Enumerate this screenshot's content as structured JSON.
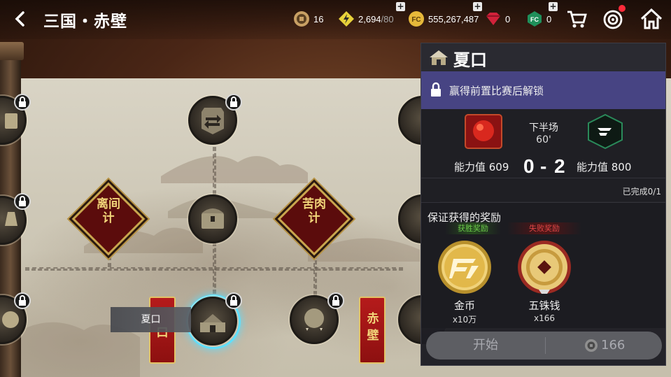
{
  "header": {
    "title": "三国・赤壁"
  },
  "resources": [
    {
      "name": "copper-coin",
      "value": "16",
      "suffix": ""
    },
    {
      "name": "energy",
      "value": "2,694",
      "suffix": "/80"
    },
    {
      "name": "gold-coin",
      "value": "555,267,487",
      "suffix": ""
    },
    {
      "name": "red-gem",
      "value": "0",
      "suffix": ""
    },
    {
      "name": "green-gem",
      "value": "0",
      "suffix": ""
    }
  ],
  "map": {
    "diamond_1": "离间计",
    "diamond_2": "苦肉计",
    "banner_1": "赤壁",
    "banner_partial": "口",
    "tooltip": "夏口"
  },
  "panel": {
    "title": "夏口",
    "unlock_text": "赢得前置比赛后解锁",
    "match": {
      "half": "下半场",
      "minute": "60'",
      "home_power_label": "能力值 609",
      "away_power_label": "能力值 800",
      "home_score": "0",
      "separator": "-",
      "away_score": "2"
    },
    "progress": "已完成0/1",
    "rewards_title": "保证获得的奖励",
    "win_tag": "获胜奖励",
    "lose_tag": "失败奖励",
    "rewards": [
      {
        "name": "金币",
        "qty": "x10万"
      },
      {
        "name": "五铢钱",
        "qty": "x166"
      }
    ],
    "start_label": "开始",
    "cost": "166"
  },
  "colors": {
    "accent_cyan": "#5de0ff",
    "unlock_bar": "#474483",
    "diamond_red": "#5b0c0c",
    "gold": "#c9a64e"
  }
}
